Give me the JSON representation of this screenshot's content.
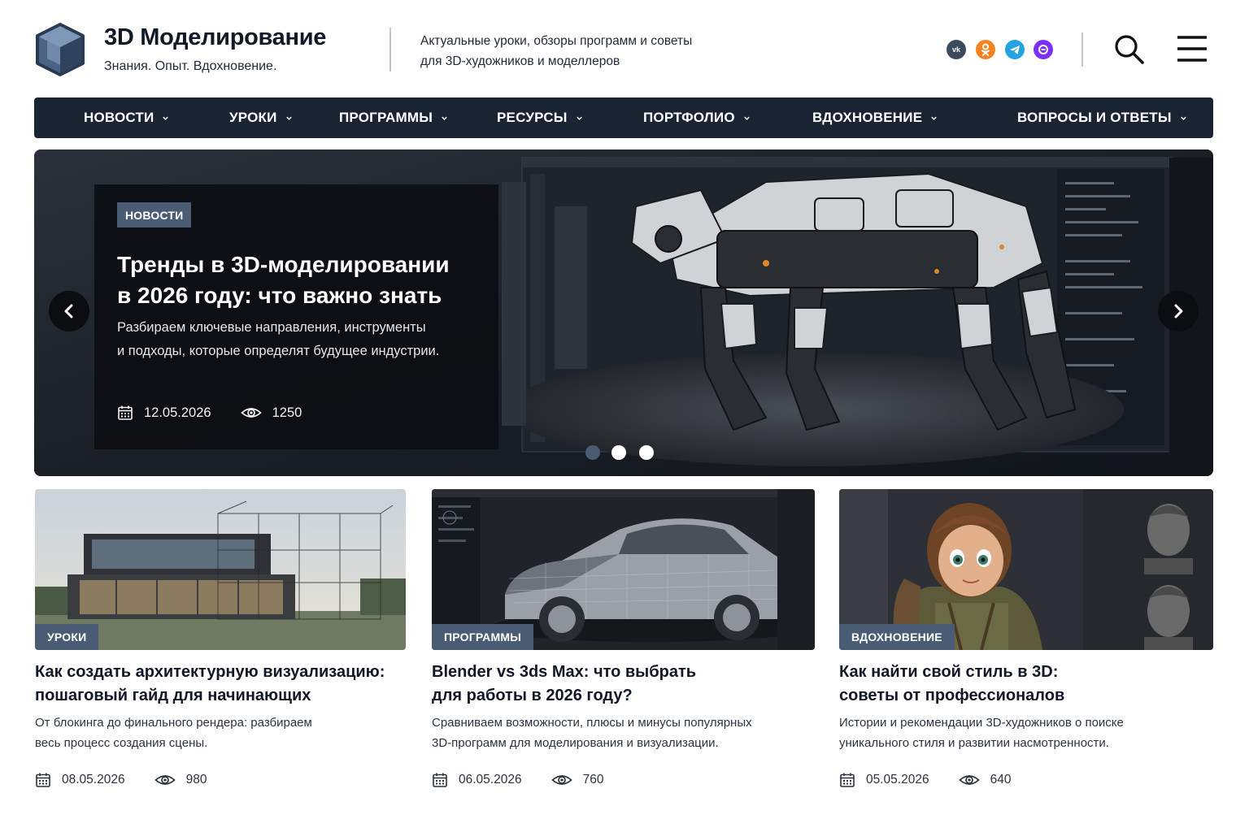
{
  "site": {
    "title": "3D Моделирование",
    "tagline": "Знания. Опыт. Вдохновение.",
    "description_line1": "Актуальные уроки, обзоры программ и советы",
    "description_line2": "для 3D-художников и моделлеров"
  },
  "social": [
    {
      "name": "vk",
      "glyph": "vk"
    },
    {
      "name": "odnoklassniki",
      "glyph": "ok"
    },
    {
      "name": "telegram",
      "glyph": "➤"
    },
    {
      "name": "max",
      "glyph": "◌"
    }
  ],
  "nav": [
    {
      "label": "НОВОСТИ"
    },
    {
      "label": "УРОКИ"
    },
    {
      "label": "ПРОГРАММЫ"
    },
    {
      "label": "РЕСУРСЫ"
    },
    {
      "label": "ПОРТФОЛИО"
    },
    {
      "label": "ВДОХНОВЕНИЕ"
    },
    {
      "label": "ВОПРОСЫ И ОТВЕТЫ"
    }
  ],
  "hero": {
    "badge": "НОВОСТИ",
    "title_line1": "Тренды в 3D-моделировании",
    "title_line2": "в 2026 году: что важно знать",
    "desc_line1": "Разбираем ключевые направления, инструменты",
    "desc_line2": "и подходы, которые определят будущее индустрии.",
    "date": "12.05.2026",
    "views": "1250",
    "active_slide": 1,
    "slide_count": 3
  },
  "cards": [
    {
      "badge": "УРОКИ",
      "title_line1": "Как создать архитектурную визуализацию:",
      "title_line2": "пошаговый гайд для начинающих",
      "desc_line1": "От блокинга до финального рендера: разбираем",
      "desc_line2": "весь процесс создания сцены.",
      "date": "08.05.2026",
      "views": "980"
    },
    {
      "badge": "ПРОГРАММЫ",
      "title_line1": "Blender vs 3ds Max: что выбрать",
      "title_line2": "для работы в 2026 году?",
      "desc_line1": "Сравниваем возможности, плюсы и минусы популярных",
      "desc_line2": "3D-программ для моделирования и визуализации.",
      "date": "06.05.2026",
      "views": "760"
    },
    {
      "badge": "ВДОХНОВЕНИЕ",
      "title_line1": "Как найти свой стиль в 3D:",
      "title_line2": "советы от профессионалов",
      "desc_line1": "Истории и рекомендации 3D-художников о поиске",
      "desc_line2": "уникального стиля и развитии насмотренности.",
      "date": "05.05.2026",
      "views": "640"
    }
  ],
  "colors": {
    "nav_bg": "#1b2433",
    "badge_bg": "#4a5b74",
    "active_dot": "#4a5b74"
  }
}
